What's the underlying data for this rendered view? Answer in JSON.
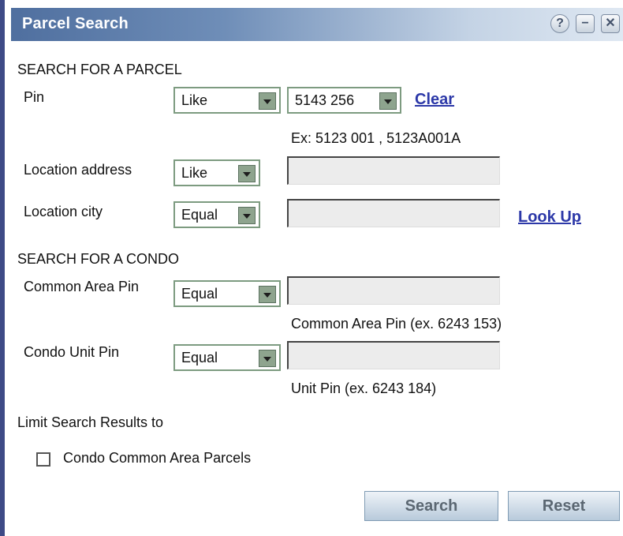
{
  "window": {
    "title": "Parcel Search",
    "help_icon": "?",
    "minimize_icon": "−",
    "close_icon": "✕"
  },
  "parcel": {
    "heading": "SEARCH FOR A PARCEL",
    "pin": {
      "label": "Pin",
      "operator": "Like",
      "value": "5143 256",
      "hint": "Ex: 5123 001 , 5123A001A",
      "clear_label": "Clear"
    },
    "location_address": {
      "label": "Location address",
      "operator": "Like",
      "value": ""
    },
    "location_city": {
      "label": "Location city",
      "operator": "Equal",
      "value": "",
      "lookup_label": "Look Up"
    }
  },
  "condo": {
    "heading": "SEARCH FOR A CONDO",
    "common_area_pin": {
      "label": "Common Area Pin",
      "operator": "Equal",
      "value": "",
      "hint": "Common Area Pin (ex. 6243 153)"
    },
    "condo_unit_pin": {
      "label": "Condo Unit Pin",
      "operator": "Equal",
      "value": "",
      "hint": "Unit Pin (ex. 6243 184)"
    }
  },
  "limit": {
    "heading": "Limit Search Results to",
    "checkbox_label": "Condo Common Area Parcels",
    "checked": false
  },
  "buttons": {
    "search": "Search",
    "reset": "Reset"
  }
}
